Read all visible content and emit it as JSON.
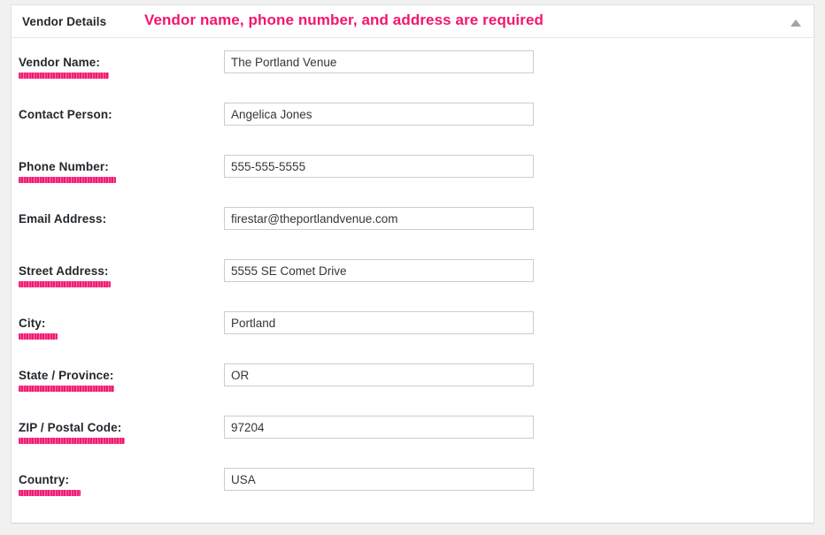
{
  "panel": {
    "title": "Vendor Details",
    "alert_message": "Vendor name, phone number, and address are required",
    "alert_color": "#f4156c",
    "collapse_icon": "triangle-up-icon"
  },
  "form": {
    "fields": [
      {
        "label": "Vendor Name:",
        "value": "The Portland Venue",
        "placeholder": "",
        "required": true,
        "marker_width": 102
      },
      {
        "label": "Contact Person:",
        "value": "Angelica Jones",
        "placeholder": "",
        "required": false,
        "marker_width": 0
      },
      {
        "label": "Phone Number:",
        "value": "555-555-5555",
        "placeholder": "",
        "required": true,
        "marker_width": 110
      },
      {
        "label": "Email Address:",
        "value": "firestar@theportlandvenue.com",
        "placeholder": "",
        "required": false,
        "marker_width": 0
      },
      {
        "label": "Street Address:",
        "value": "5555 SE Comet Drive",
        "placeholder": "",
        "required": true,
        "marker_width": 104
      },
      {
        "label": "City:",
        "value": "Portland",
        "placeholder": "",
        "required": true,
        "marker_width": 44
      },
      {
        "label": "State / Province:",
        "value": "OR",
        "placeholder": "",
        "required": true,
        "marker_width": 108
      },
      {
        "label": "ZIP / Postal Code:",
        "value": "97204",
        "placeholder": "",
        "required": true,
        "marker_width": 120
      },
      {
        "label": "Country:",
        "value": "USA",
        "placeholder": "",
        "required": true,
        "marker_width": 70
      }
    ]
  }
}
